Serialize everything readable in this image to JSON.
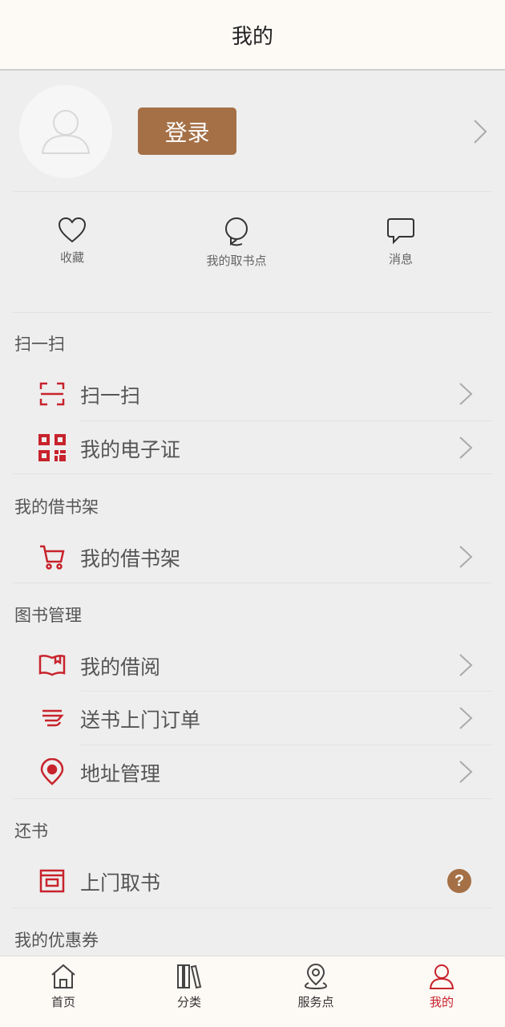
{
  "header": {
    "title": "我的"
  },
  "profile": {
    "login_label": "登录"
  },
  "quick": [
    {
      "label": "收藏",
      "icon": "heart-icon"
    },
    {
      "label": "我的取书点",
      "icon": "location-pin-icon"
    },
    {
      "label": "消息",
      "icon": "message-icon"
    }
  ],
  "sections": {
    "scan": {
      "title": "扫一扫",
      "rows": [
        {
          "label": "扫一扫",
          "icon": "scan-icon"
        },
        {
          "label": "我的电子证",
          "icon": "qr-code-icon"
        }
      ]
    },
    "shelf": {
      "title": "我的借书架",
      "rows": [
        {
          "label": "我的借书架",
          "icon": "cart-icon"
        }
      ]
    },
    "manage": {
      "title": "图书管理",
      "rows": [
        {
          "label": "我的借阅",
          "icon": "book-icon"
        },
        {
          "label": "送书上门订单",
          "icon": "delivery-icon"
        },
        {
          "label": "地址管理",
          "icon": "map-pin-icon"
        }
      ]
    },
    "return": {
      "title": "还书",
      "rows": [
        {
          "label": "上门取书",
          "icon": "pickup-box-icon",
          "badge": "?"
        }
      ]
    },
    "coupons": {
      "title": "我的优惠券"
    }
  },
  "tabbar": [
    {
      "label": "首页",
      "icon": "home-icon"
    },
    {
      "label": "分类",
      "icon": "books-icon"
    },
    {
      "label": "服务点",
      "icon": "service-point-icon"
    },
    {
      "label": "我的",
      "icon": "user-icon",
      "active": true
    }
  ],
  "colors": {
    "accent_brown": "#a57046",
    "accent_red": "#c8232c",
    "background": "#eeeeee",
    "header_bg": "#fdf9f5"
  }
}
